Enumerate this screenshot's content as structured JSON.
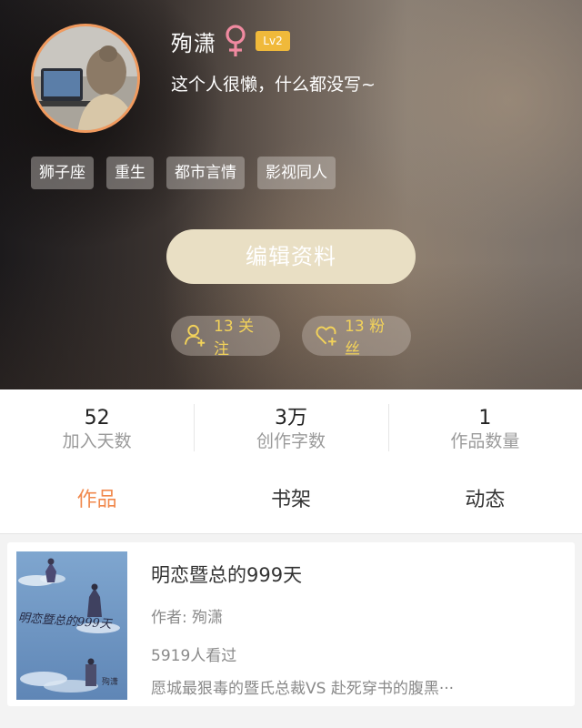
{
  "profile": {
    "username": "殉潇",
    "gender_icon": "female-icon",
    "level": "Lv2",
    "bio": "这个人很懒，什么都没写~",
    "tags": [
      "狮子座",
      "重生",
      "都市言情",
      "影视同人"
    ],
    "edit_button_label": "编辑资料",
    "following": {
      "label": "13 关注",
      "icon": "user-plus-icon"
    },
    "fans": {
      "label": "13 粉丝",
      "icon": "heart-plus-icon"
    }
  },
  "stats": [
    {
      "value": "52",
      "label": "加入天数"
    },
    {
      "value": "3万",
      "label": "创作字数"
    },
    {
      "value": "1",
      "label": "作品数量"
    }
  ],
  "tabs": [
    {
      "label": "作品",
      "active": true
    },
    {
      "label": "书架",
      "active": false
    },
    {
      "label": "动态",
      "active": false
    }
  ],
  "books": [
    {
      "title": "明恋暨总的999天",
      "author_line": "作者: 殉潇",
      "views": "5919人看过",
      "description": "愿城最狠毒的暨氏总裁VS 赴死穿书的腹黑···",
      "cover_title": "明恋暨总的999天",
      "cover_author": "殉潇"
    }
  ],
  "colors": {
    "accent": "#f1894d",
    "level_badge": "#f0b93a",
    "follow_text": "#f2d25a",
    "edit_button": "#e9dfc4",
    "avatar_border": "#f19a5e"
  }
}
